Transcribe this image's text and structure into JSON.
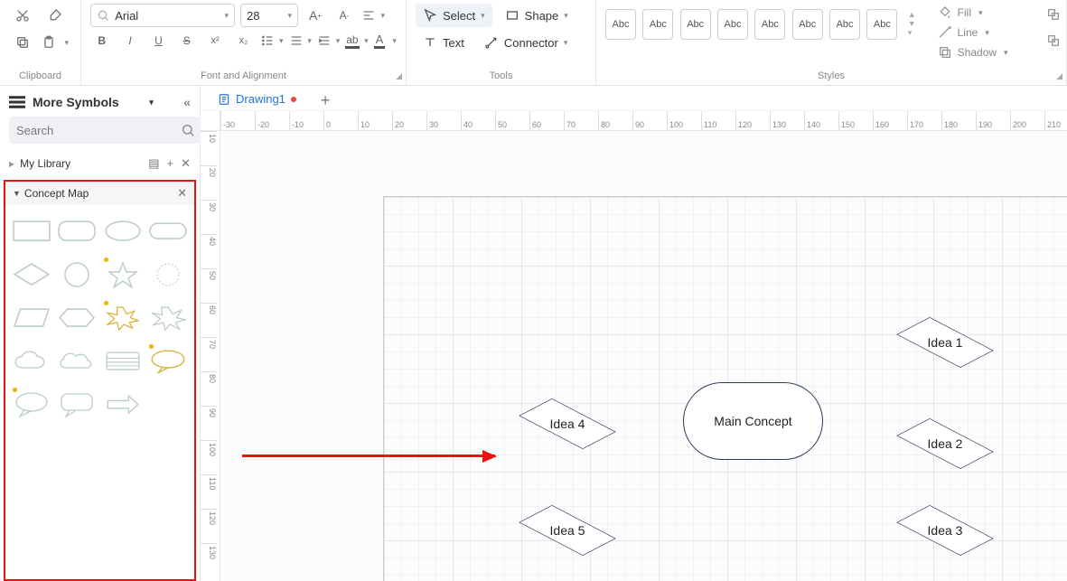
{
  "ribbon": {
    "clipboard": {
      "label": "Clipboard"
    },
    "font": {
      "label": "Font and Alignment",
      "font_name": "Arial",
      "font_size": "28"
    },
    "tools": {
      "label": "Tools",
      "select": "Select",
      "shape": "Shape",
      "text": "Text",
      "connector": "Connector"
    },
    "styles": {
      "label": "Styles",
      "swatch": "Abc",
      "fill": "Fill",
      "line": "Line",
      "shadow": "Shadow"
    }
  },
  "left": {
    "more_symbols": "More Symbols",
    "search_placeholder": "Search",
    "my_library": "My Library",
    "category": "Concept Map"
  },
  "tabs": {
    "drawing1": "Drawing1"
  },
  "ruler_h": [
    "-30",
    "-20",
    "-10",
    "0",
    "10",
    "20",
    "30",
    "40",
    "50",
    "60",
    "70",
    "80",
    "90",
    "100",
    "110",
    "120",
    "130",
    "140",
    "150",
    "160",
    "170",
    "180",
    "190",
    "200",
    "210"
  ],
  "ruler_v": [
    "10",
    "20",
    "30",
    "40",
    "50",
    "60",
    "70",
    "80",
    "90",
    "100",
    "110",
    "120",
    "130"
  ],
  "canvas": {
    "main": "Main Concept",
    "idea1": "Idea 1",
    "idea2": "Idea 2",
    "idea3": "Idea 3",
    "idea4": "Idea 4",
    "idea5": "Idea 5"
  }
}
